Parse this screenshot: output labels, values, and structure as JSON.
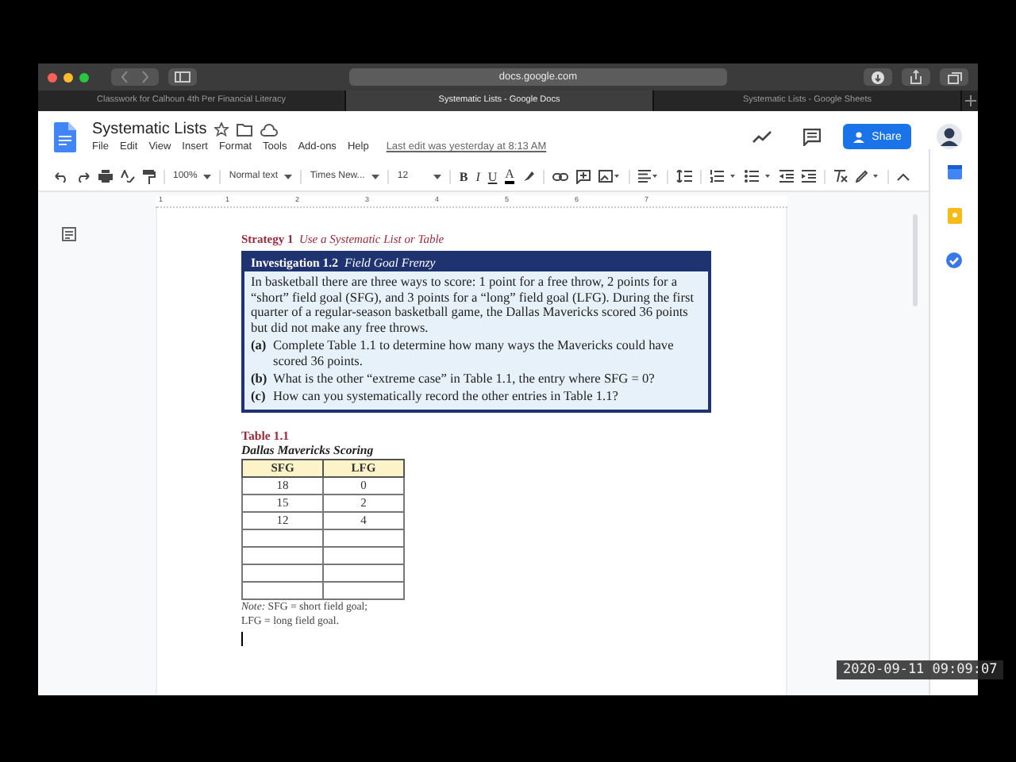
{
  "browser": {
    "address": "docs.google.com",
    "tabs": [
      {
        "label": "Classwork for Calhoun 4th Per Financial Literacy",
        "selected": false
      },
      {
        "label": "Systematic Lists - Google Docs",
        "selected": true
      },
      {
        "label": "Systematic Lists - Google Sheets",
        "selected": false
      }
    ]
  },
  "doc": {
    "title": "Systematic Lists",
    "menu": [
      "File",
      "Edit",
      "View",
      "Insert",
      "Format",
      "Tools",
      "Add-ons",
      "Help"
    ],
    "last_edit": "Last edit was yesterday at 8:13 AM",
    "share": "Share"
  },
  "toolbar": {
    "zoom": "100%",
    "style": "Normal text",
    "font": "Times New...",
    "size": "12",
    "format": [
      "B",
      "I",
      "U",
      "A"
    ]
  },
  "ruler": [
    "1",
    "1",
    "2",
    "3",
    "4",
    "5",
    "6",
    "7"
  ],
  "page": {
    "strategy_label": "Strategy 1",
    "strategy_title": "Use a Systematic List or Table",
    "investigation": {
      "label": "Investigation 1.2",
      "title": "Field Goal Frenzy",
      "intro": "In basketball there are three ways to score: 1 point for a free throw, 2 points for a “short” field goal (SFG), and 3 points for a “long” field goal (LFG). During the first quarter of a regular-season basketball game, the Dallas Mavericks scored 36 points but did not make any free throws.",
      "questions": [
        {
          "letter": "(a)",
          "text": "Complete Table 1.1 to determine how many ways the Mavericks could have scored 36 points."
        },
        {
          "letter": "(b)",
          "text": "What is the other “extreme case” in Table 1.1, the entry where SFG = 0?"
        },
        {
          "letter": "(c)",
          "text": "How can you systematically record the other entries in Table 1.1?"
        }
      ]
    },
    "table": {
      "label": "Table 1.1",
      "caption": "Dallas Mavericks Scoring",
      "columns": [
        "SFG",
        "LFG"
      ],
      "rows": [
        {
          "kind": "entry",
          "sfg": "18",
          "lfg": "0"
        },
        {
          "kind": "entry",
          "sfg": "15",
          "lfg": "2"
        },
        {
          "kind": "entry",
          "sfg": "12",
          "lfg": "4"
        },
        {
          "kind": "blank"
        },
        {
          "kind": "blank"
        },
        {
          "kind": "blank"
        },
        {
          "kind": "blank"
        }
      ]
    },
    "note": [
      "*Note:* SFG = short field goal;",
      "LFG = long field goal."
    ]
  },
  "timestamp": "2020-09-11 09:09:07"
}
